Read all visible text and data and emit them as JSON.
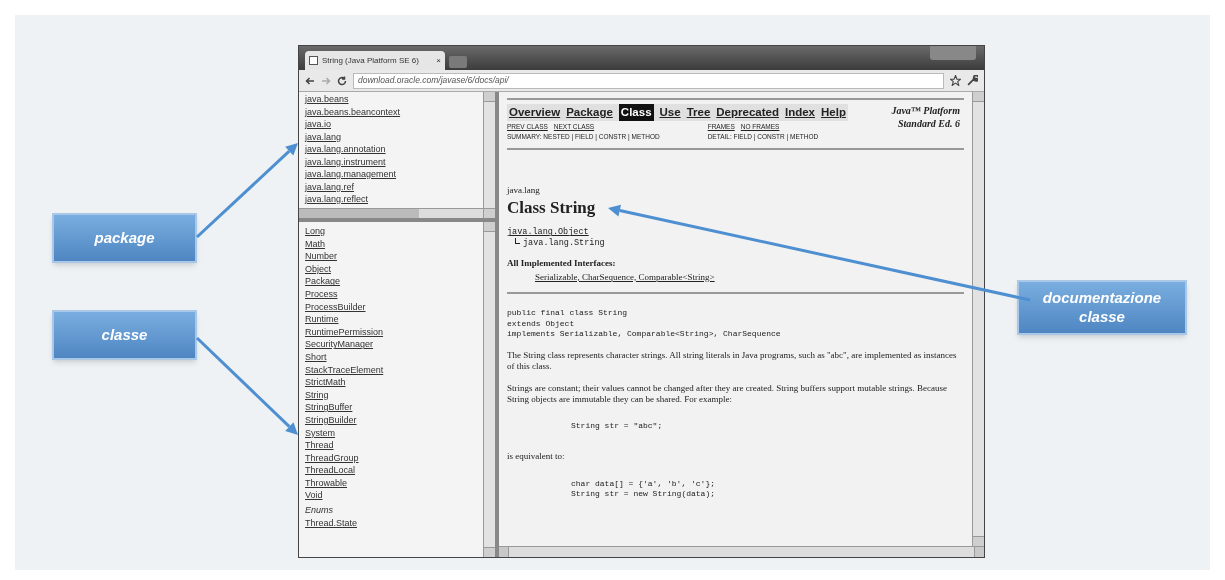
{
  "callouts": [
    {
      "text": "package"
    },
    {
      "text": "classe"
    },
    {
      "text": "documentazione classe"
    }
  ],
  "browser": {
    "tab_title": "String (Java Platform SE 6)",
    "tab_close": "×",
    "url": "download.oracle.com/javase/6/docs/api/"
  },
  "package_list": [
    "java.beans",
    "java.beans.beancontext",
    "java.io",
    "java.lang",
    "java.lang.annotation",
    "java.lang.instrument",
    "java.lang.management",
    "java.lang.ref",
    "java.lang.reflect"
  ],
  "class_list": [
    {
      "kind": "link",
      "text": "Long"
    },
    {
      "kind": "link",
      "text": "Math"
    },
    {
      "kind": "link",
      "text": "Number"
    },
    {
      "kind": "link",
      "text": "Object"
    },
    {
      "kind": "link",
      "text": "Package"
    },
    {
      "kind": "link",
      "text": "Process"
    },
    {
      "kind": "link",
      "text": "ProcessBuilder"
    },
    {
      "kind": "link",
      "text": "Runtime"
    },
    {
      "kind": "link",
      "text": "RuntimePermission"
    },
    {
      "kind": "link",
      "text": "SecurityManager"
    },
    {
      "kind": "link",
      "text": "Short"
    },
    {
      "kind": "link",
      "text": "StackTraceElement"
    },
    {
      "kind": "link",
      "text": "StrictMath"
    },
    {
      "kind": "link",
      "text": "String"
    },
    {
      "kind": "link",
      "text": "StringBuffer"
    },
    {
      "kind": "link",
      "text": "StringBuilder"
    },
    {
      "kind": "link",
      "text": "System"
    },
    {
      "kind": "link",
      "text": "Thread"
    },
    {
      "kind": "link",
      "text": "ThreadGroup"
    },
    {
      "kind": "link",
      "text": "ThreadLocal"
    },
    {
      "kind": "link",
      "text": "Throwable"
    },
    {
      "kind": "link",
      "text": "Void"
    },
    {
      "kind": "heading",
      "text": "Enums"
    },
    {
      "kind": "link",
      "text": "Thread.State"
    }
  ],
  "doc": {
    "nav": [
      {
        "label": "Overview",
        "selected": false
      },
      {
        "label": "Package",
        "selected": false
      },
      {
        "label": "Class",
        "selected": true
      },
      {
        "label": "Use",
        "selected": false
      },
      {
        "label": "Tree",
        "selected": false
      },
      {
        "label": "Deprecated",
        "selected": false
      },
      {
        "label": "Index",
        "selected": false
      },
      {
        "label": "Help",
        "selected": false
      }
    ],
    "platform": [
      "Java™ Platform",
      "Standard Ed. 6"
    ],
    "prev_next": [
      "PREV CLASS",
      "NEXT CLASS"
    ],
    "frames": [
      "FRAMES",
      "NO FRAMES"
    ],
    "summary": "SUMMARY: NESTED | FIELD | CONSTR | METHOD",
    "detail": "DETAIL: FIELD | CONSTR | METHOD",
    "package_name": "java.lang",
    "title": "Class String",
    "hierarchy": [
      "java.lang.Object",
      "java.lang.String"
    ],
    "interfaces_label": "All Implemented Interfaces:",
    "interfaces": "Serializable, CharSequence, Comparable<String>",
    "declaration": [
      "public final class String",
      "extends Object",
      "implements Serializable, Comparable<String>, CharSequence"
    ],
    "paragraphs": [
      "The String class represents character strings. All string literals in Java programs, such as \"abc\", are implemented as instances of this class.",
      "Strings are constant; their values cannot be changed after they are created. String buffers support mutable strings. Because String objects are immutable they can be shared. For example:"
    ],
    "code1": "String str = \"abc\";",
    "equiv": "is equivalent to:",
    "code2": [
      "char data[] = {'a', 'b', 'c'};",
      "String str = new String(data);"
    ]
  }
}
